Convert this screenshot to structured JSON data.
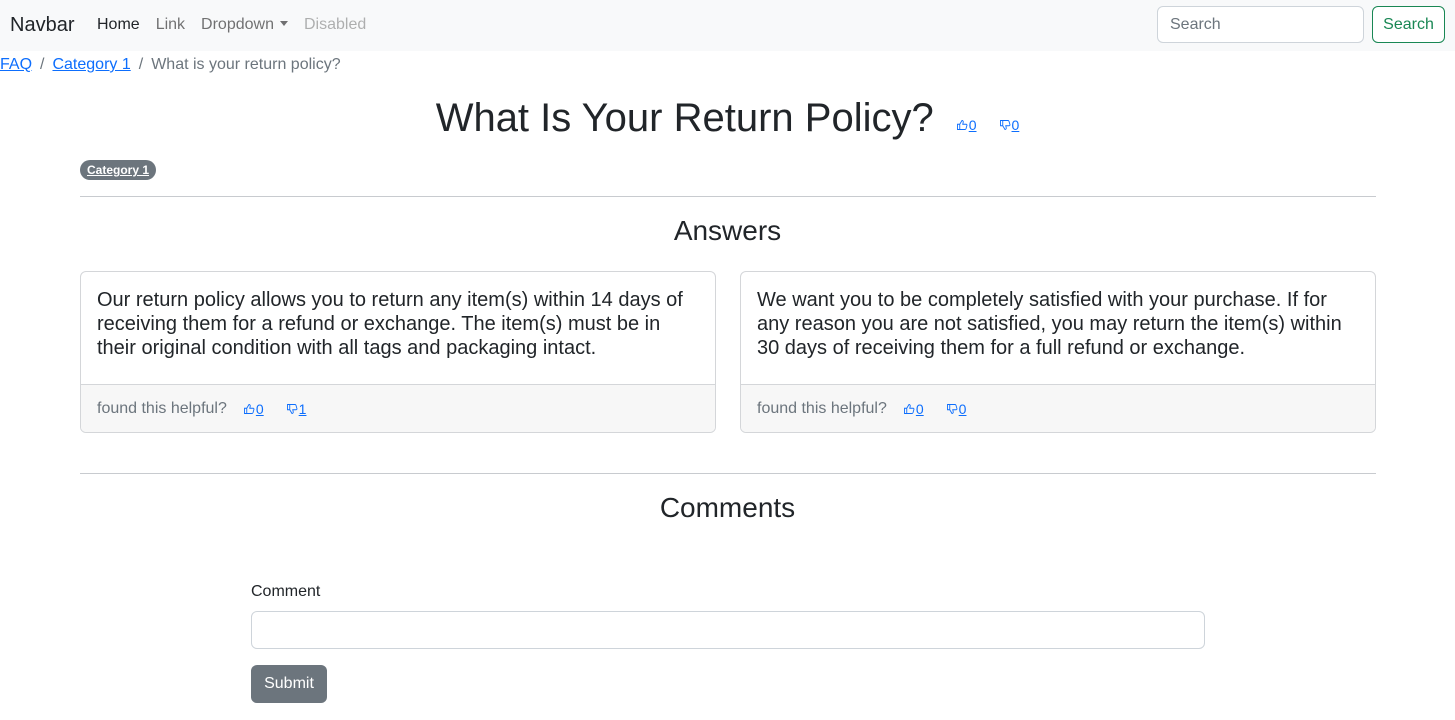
{
  "navbar": {
    "brand": "Navbar",
    "links": [
      {
        "label": "Home",
        "state": "active"
      },
      {
        "label": "Link",
        "state": "normal"
      },
      {
        "label": "Dropdown",
        "state": "dropdown"
      },
      {
        "label": "Disabled",
        "state": "disabled"
      }
    ],
    "search_placeholder": "Search",
    "search_button": "Search"
  },
  "breadcrumb": {
    "items": [
      "FAQ",
      "Category 1"
    ],
    "current": "What is your return policy?",
    "separator": "/"
  },
  "question": {
    "title": "What Is Your Return Policy?",
    "upvotes": "0",
    "downvotes": "0",
    "category_badge": "Category 1"
  },
  "answers": {
    "heading": "Answers",
    "items": [
      {
        "text": "Our return policy allows you to return any item(s) within 14 days of receiving them for a refund or exchange. The item(s) must be in their original condition with all tags and packaging intact.",
        "helpful_label": "found this helpful?",
        "upvotes": "0",
        "downvotes": "1"
      },
      {
        "text": "We want you to be completely satisfied with your purchase. If for any reason you are not satisfied, you may return the item(s) within 30 days of receiving them for a full refund or exchange.",
        "helpful_label": "found this helpful?",
        "upvotes": "0",
        "downvotes": "0"
      }
    ]
  },
  "comments": {
    "heading": "Comments",
    "label": "Comment",
    "value": "",
    "submit_label": "Submit"
  },
  "colors": {
    "primary": "#0d6efd",
    "success": "#198754",
    "secondary": "#6c757d",
    "navbar_bg": "#f8f9fa"
  }
}
